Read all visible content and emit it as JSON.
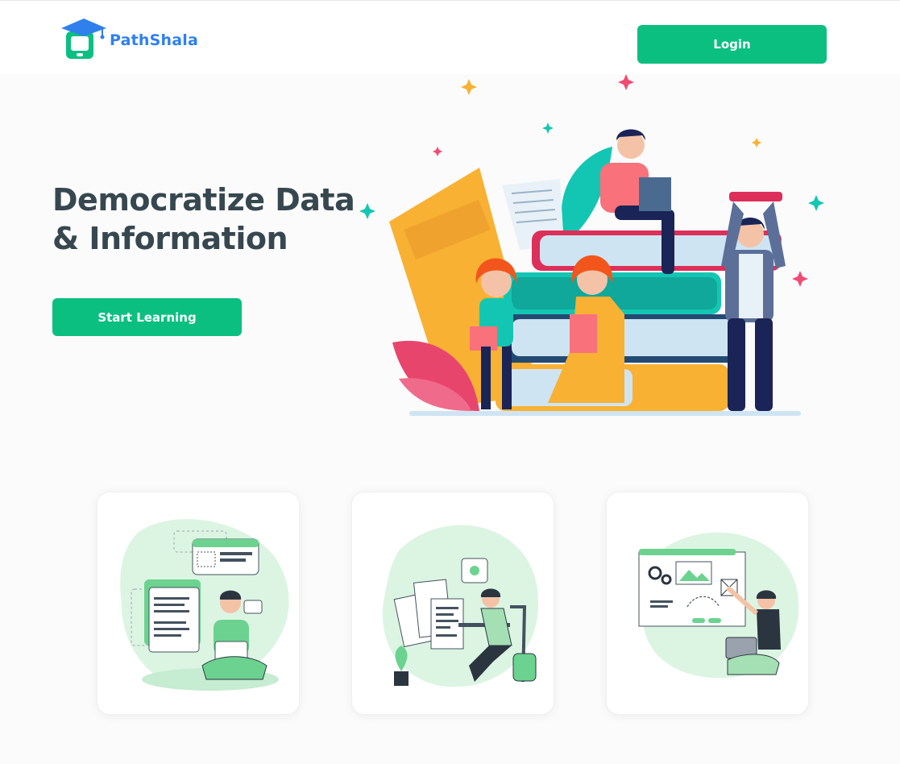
{
  "brand": {
    "name": "PathShala",
    "logo_icon": "graduation-cap-monitor-icon",
    "color": "#2f80ed"
  },
  "nav": {
    "login_label": "Login"
  },
  "hero": {
    "title": "Democratize Data & Information",
    "cta_label": "Start Learning",
    "illustration": "students-reading-books-illustration"
  },
  "cards": [
    {
      "illustration": "developer-with-laptop-illustration"
    },
    {
      "illustration": "student-filling-forms-illustration"
    },
    {
      "illustration": "presenter-at-whiteboard-illustration"
    }
  ],
  "colors": {
    "accent": "#0bbf80",
    "title": "#37474f",
    "background": "#fbfbfb"
  }
}
